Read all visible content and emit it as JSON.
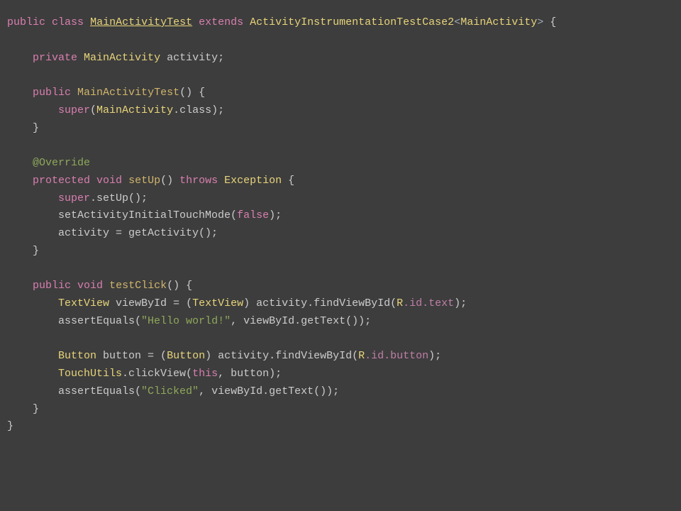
{
  "code": {
    "l1_public": "public",
    "l1_class": "class",
    "l1_name": "MainActivityTest",
    "l1_extends": "extends",
    "l1_super": "ActivityInstrumentationTestCase2",
    "l1_lt": "<",
    "l1_gen": "MainActivity",
    "l1_gt": ">",
    "l1_ob": " {",
    "l3_private": "private",
    "l3_type": "MainActivity",
    "l3_var": "activity;",
    "l5_public": "public",
    "l5_name": "MainActivityTest",
    "l5_rest": "() {",
    "l6_super": "super",
    "l6_arg_cls": "MainActivity",
    "l6_rest1": "(",
    "l6_rest2": ".class);",
    "l7_cb": "}",
    "l9_ann": "@Override",
    "l10_protected": "protected",
    "l10_void": "void",
    "l10_name": "setUp",
    "l10_paren": "()",
    "l10_throws": "throws",
    "l10_exc": "Exception",
    "l10_ob": " {",
    "l11_super": "super",
    "l11_call": ".setUp();",
    "l12_call": "setActivityInitialTouchMode(",
    "l12_false": "false",
    "l12_end": ");",
    "l13_line": "activity = getActivity();",
    "l14_cb": "}",
    "l16_public": "public",
    "l16_void": "void",
    "l16_name": "testClick",
    "l16_rest": "() {",
    "l17_type": "TextView",
    "l17_var": "viewById = (",
    "l17_cast": "TextView",
    "l17_mid": ") activity.findViewById(",
    "l17_r": "R",
    "l17_id": ".id.text",
    "l17_end": ");",
    "l18_call": "assertEquals(",
    "l18_str": "\"Hello world!\"",
    "l18_rest": ", viewById.getText());",
    "l20_type": "Button",
    "l20_var": "button = (",
    "l20_cast": "Button",
    "l20_mid": ") activity.findViewById(",
    "l20_r": "R",
    "l20_id": ".id.button",
    "l20_end": ");",
    "l21_cls": "TouchUtils",
    "l21_call": ".clickView(",
    "l21_this": "this",
    "l21_rest": ", button);",
    "l22_call": "assertEquals(",
    "l22_str": "\"Clicked\"",
    "l22_rest": ", viewById.getText());",
    "l23_cb": "}",
    "l24_cb": "}"
  }
}
